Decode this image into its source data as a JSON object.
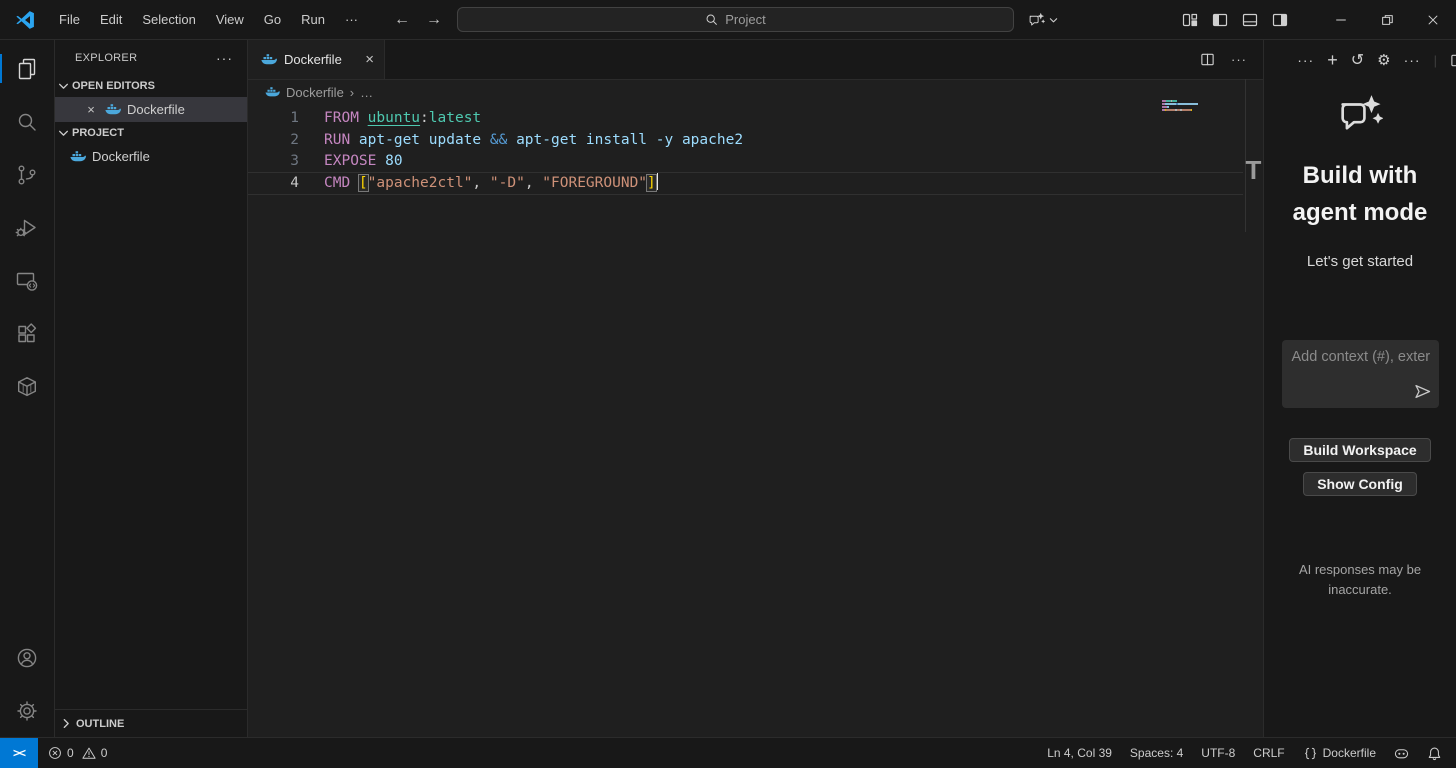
{
  "titlebar": {
    "menus": [
      "File",
      "Edit",
      "Selection",
      "View",
      "Go",
      "Run"
    ],
    "menu_overflow": "···",
    "nav": {
      "back": "←",
      "forward": "→"
    },
    "search": {
      "placeholder": "Project",
      "icon": "search-icon"
    },
    "copilot_icon": "copilot-chat-icon",
    "layout_icons": [
      "customize-layout",
      "toggle-primary-sidebar",
      "toggle-panel",
      "toggle-secondary-sidebar"
    ],
    "window_controls": [
      "minimize",
      "restore",
      "close"
    ]
  },
  "activity_bar": {
    "active": "files",
    "top_icons": [
      "files",
      "search",
      "source-control",
      "run-and-debug",
      "remote-explorer",
      "extensions",
      "docker"
    ],
    "bottom_icons": [
      "accounts",
      "settings-gear"
    ]
  },
  "sidebar": {
    "title": "EXPLORER",
    "more_actions": "···",
    "open_editors": {
      "label": "OPEN EDITORS",
      "items": [
        {
          "label": "Dockerfile",
          "icon": "docker-file-icon",
          "selected": true,
          "close_glyph": "×"
        }
      ]
    },
    "project": {
      "label": "PROJECT",
      "items": [
        {
          "label": "Dockerfile",
          "icon": "docker-file-icon"
        }
      ]
    },
    "outline": {
      "label": "OUTLINE"
    }
  },
  "editor": {
    "tab": {
      "label": "Dockerfile",
      "icon": "docker-file-icon",
      "close_glyph": "×"
    },
    "breadcrumb": {
      "file": "Dockerfile",
      "separator": "›",
      "more": "…"
    },
    "overlay_letter": "T",
    "cursor_line": 4,
    "token_colors": {
      "keyword": "#C586C0",
      "link": "#4EC9B0",
      "type": "#4EC9B0",
      "variable": "#9CDCFE",
      "operator": "#569CD6",
      "string": "#CE9178",
      "plain": "#CCCCCC",
      "bracket": "#FFD700"
    },
    "lines": [
      {
        "num": "1",
        "tokens": [
          [
            "FROM ",
            "keyword"
          ],
          [
            "ubuntu",
            "link"
          ],
          [
            ":",
            "plain"
          ],
          [
            "latest",
            "type"
          ]
        ]
      },
      {
        "num": "2",
        "tokens": [
          [
            "RUN ",
            "keyword"
          ],
          [
            "apt-get update ",
            "variable"
          ],
          [
            "&& ",
            "operator"
          ],
          [
            "apt-get install -y apache2",
            "variable"
          ]
        ]
      },
      {
        "num": "3",
        "tokens": [
          [
            "EXPOSE ",
            "keyword"
          ],
          [
            "80",
            "variable"
          ]
        ]
      },
      {
        "num": "4",
        "tokens": [
          [
            "CMD ",
            "keyword"
          ],
          [
            "[",
            "bracket"
          ],
          [
            "\"apache2ctl\"",
            "string"
          ],
          [
            ", ",
            "plain"
          ],
          [
            "\"-D\"",
            "string"
          ],
          [
            ", ",
            "plain"
          ],
          [
            "\"FOREGROUND\"",
            "string"
          ],
          [
            "]",
            "bracket"
          ]
        ]
      }
    ]
  },
  "copilot_panel": {
    "header_icons": [
      "more",
      "new-chat",
      "history",
      "settings",
      "more",
      "open-editor"
    ],
    "glyphs": {
      "more": "···",
      "plus": "+",
      "history": "↺",
      "gear": "⚙",
      "separator": "|"
    },
    "title_lines": [
      "Build with",
      "agent mode"
    ],
    "subtitle": "Let's get started",
    "input": {
      "placeholder": "Add context (#), exter",
      "send_icon": "send-icon"
    },
    "buttons": [
      {
        "label": "Build Workspace"
      },
      {
        "label": "Show Config"
      }
    ],
    "disclaimer": "AI responses may be inaccurate."
  },
  "status_bar": {
    "remote": {
      "glyph": "><"
    },
    "problems": {
      "errors": "0",
      "warnings": "0"
    },
    "right_items": [
      {
        "label": "Ln 4, Col 39"
      },
      {
        "label": "Spaces: 4"
      },
      {
        "label": "UTF-8"
      },
      {
        "label": "CRLF"
      },
      {
        "icon": "braces",
        "label": "Dockerfile"
      },
      {
        "icon": "copilot"
      },
      {
        "icon": "bell"
      }
    ]
  },
  "colors": {
    "accent": "#0078d4",
    "editor_background": "#1f1f1f",
    "chrome_background": "#181818",
    "border": "#2b2b2b",
    "list_selection": "#37373d",
    "docker_blue": "#4BA8DC"
  }
}
